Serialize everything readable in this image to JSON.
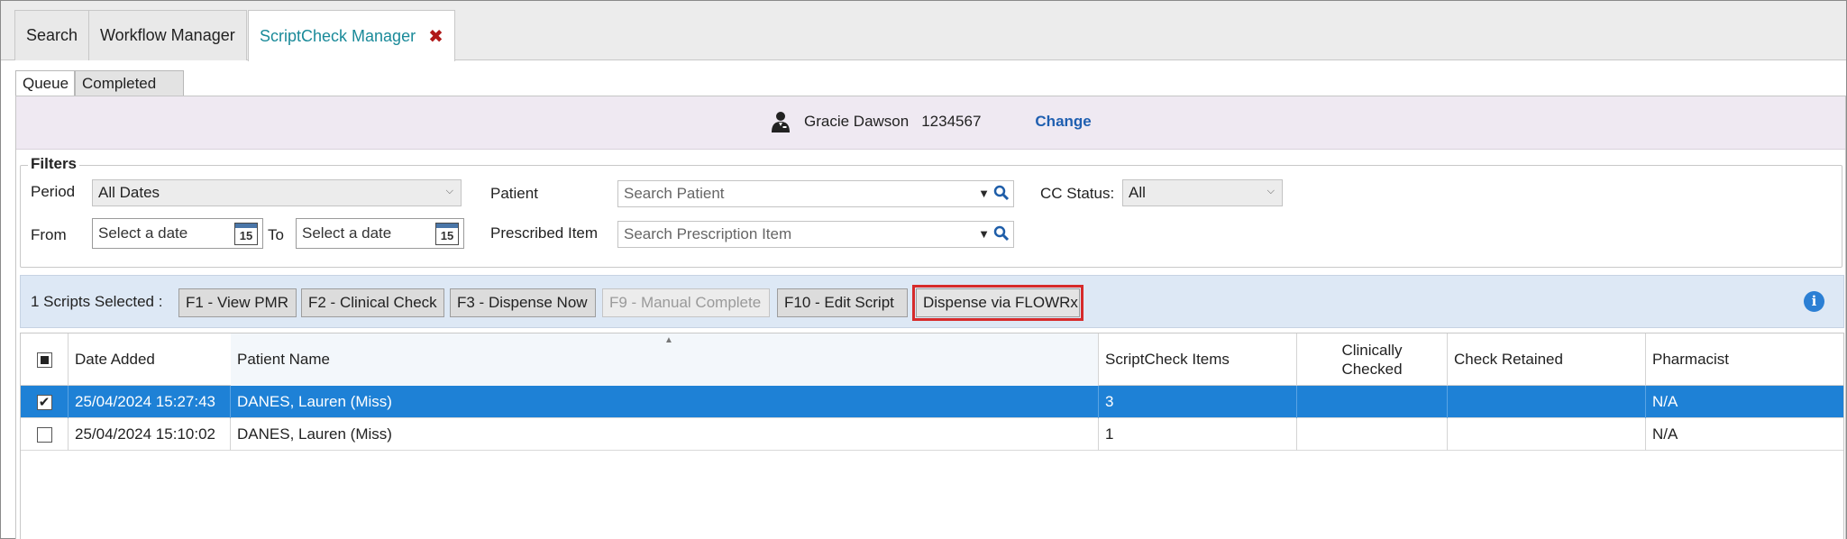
{
  "top_tabs": [
    {
      "label": "Search"
    },
    {
      "label": "Workflow Manager"
    },
    {
      "label": "ScriptCheck Manager",
      "close": "✖"
    }
  ],
  "sub_tabs": [
    {
      "label": "Queue"
    },
    {
      "label": "Completed"
    }
  ],
  "patient_bar": {
    "name": "Gracie Dawson",
    "id": "1234567",
    "change_label": "Change",
    "icon": "person-icon"
  },
  "filters": {
    "legend": "Filters",
    "period_label": "Period",
    "period_value": "All Dates",
    "from_label": "From",
    "from_placeholder": "Select a date",
    "to_label": "To",
    "to_placeholder": "Select a date",
    "calendar_day": "15",
    "patient_label": "Patient",
    "patient_placeholder": "Search Patient",
    "item_label": "Prescribed Item",
    "item_placeholder": "Search Prescription Item",
    "cc_status_label": "CC Status:",
    "cc_status_value": "All"
  },
  "toolbar": {
    "selected_label": "1 Scripts Selected :",
    "buttons": [
      {
        "label": "F1 - View PMR"
      },
      {
        "label": "F2 - Clinical Check"
      },
      {
        "label": "F3 - Dispense Now"
      },
      {
        "label": "F9 - Manual Complete"
      },
      {
        "label": "F10 - Edit Script"
      },
      {
        "label": "Dispense via FLOWRx"
      }
    ],
    "info_glyph": "i"
  },
  "grid": {
    "columns": [
      "Date Added",
      "Patient Name",
      "ScriptCheck Items",
      "Clinically Checked",
      "Check Retained",
      "Pharmacist"
    ],
    "rows": [
      {
        "checked": "✔",
        "date_added": "25/04/2024 15:27:43",
        "patient_name": "DANES, Lauren (Miss)",
        "items": "3",
        "clinically_checked": "",
        "check_retained": "",
        "pharmacist": "N/A"
      },
      {
        "checked": "",
        "date_added": "25/04/2024 15:10:02",
        "patient_name": "DANES, Lauren (Miss)",
        "items": "1",
        "clinically_checked": "",
        "check_retained": "",
        "pharmacist": "N/A"
      }
    ]
  },
  "colors": {
    "accent_tab": "#1a8a99",
    "selected_row": "#1e81d6",
    "highlight_outline": "#d62b2b",
    "link": "#1f5fb0"
  }
}
